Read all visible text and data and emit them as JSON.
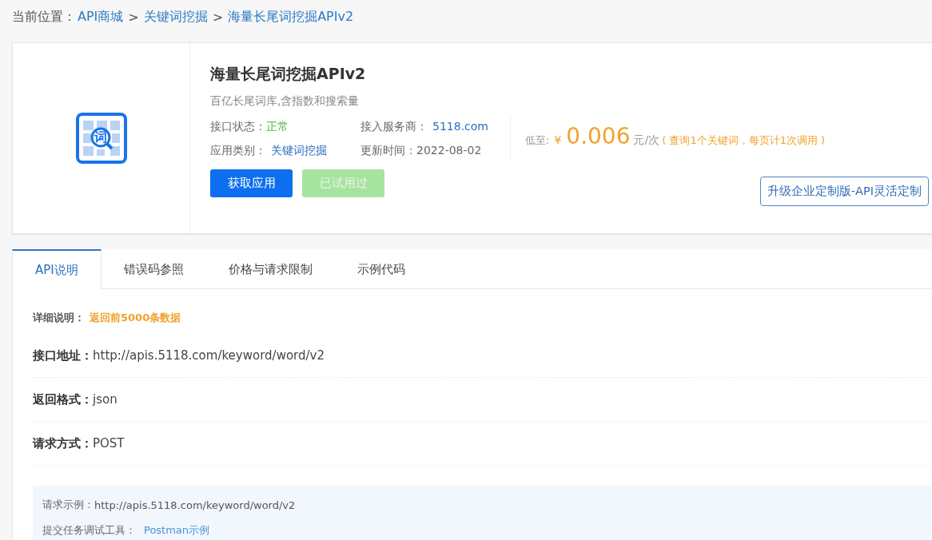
{
  "breadcrumb": {
    "label": "当前位置：",
    "links": [
      "API商城",
      "关键词挖掘",
      "海量长尾词挖掘APIv2"
    ],
    "separator": ">"
  },
  "product": {
    "logo_char": "词",
    "title": "海量长尾词挖掘APIv2",
    "subtitle": "百亿长尾词库,含指数和搜索量",
    "facts": [
      {
        "label": "接口状态：",
        "value": "正常",
        "kind": "status"
      },
      {
        "label": "接入服务商：",
        "value": "5118.com",
        "kind": "link"
      },
      {
        "label": "应用类别：",
        "value": "关键词挖掘",
        "kind": "link"
      },
      {
        "label": "更新时间：",
        "value": "2022-08-02",
        "kind": "plain"
      }
    ],
    "buttons": [
      {
        "label": "获取应用",
        "disabled": false
      },
      {
        "label": "已试用过",
        "disabled": true
      }
    ],
    "price": {
      "prefix": "低至:",
      "currency": "¥",
      "amount": "0.006",
      "unit": "元/次",
      "note": "( 查询1个关键词，每页计1次调用 )"
    },
    "upgrade_button": "升级企业定制版-API灵活定制"
  },
  "tabs": [
    {
      "label": "API说明",
      "selected": true
    },
    {
      "label": "错误码参照",
      "selected": false
    },
    {
      "label": "价格与请求限制",
      "selected": false
    },
    {
      "label": "示例代码",
      "selected": false
    }
  ],
  "detail": {
    "label": "详细说明：",
    "value": "返回前5000条数据"
  },
  "fields": [
    {
      "label": "接口地址：",
      "value": "http://apis.5118.com/keyword/word/v2"
    },
    {
      "label": "返回格式：",
      "value": "json"
    },
    {
      "label": "请求方式：",
      "value": "POST"
    }
  ],
  "example": {
    "request_label": "请求示例：",
    "request_url": "http://apis.5118.com/keyword/word/v2",
    "tool_label": "提交任务调试工具：",
    "tool_link": "Postman示例"
  }
}
